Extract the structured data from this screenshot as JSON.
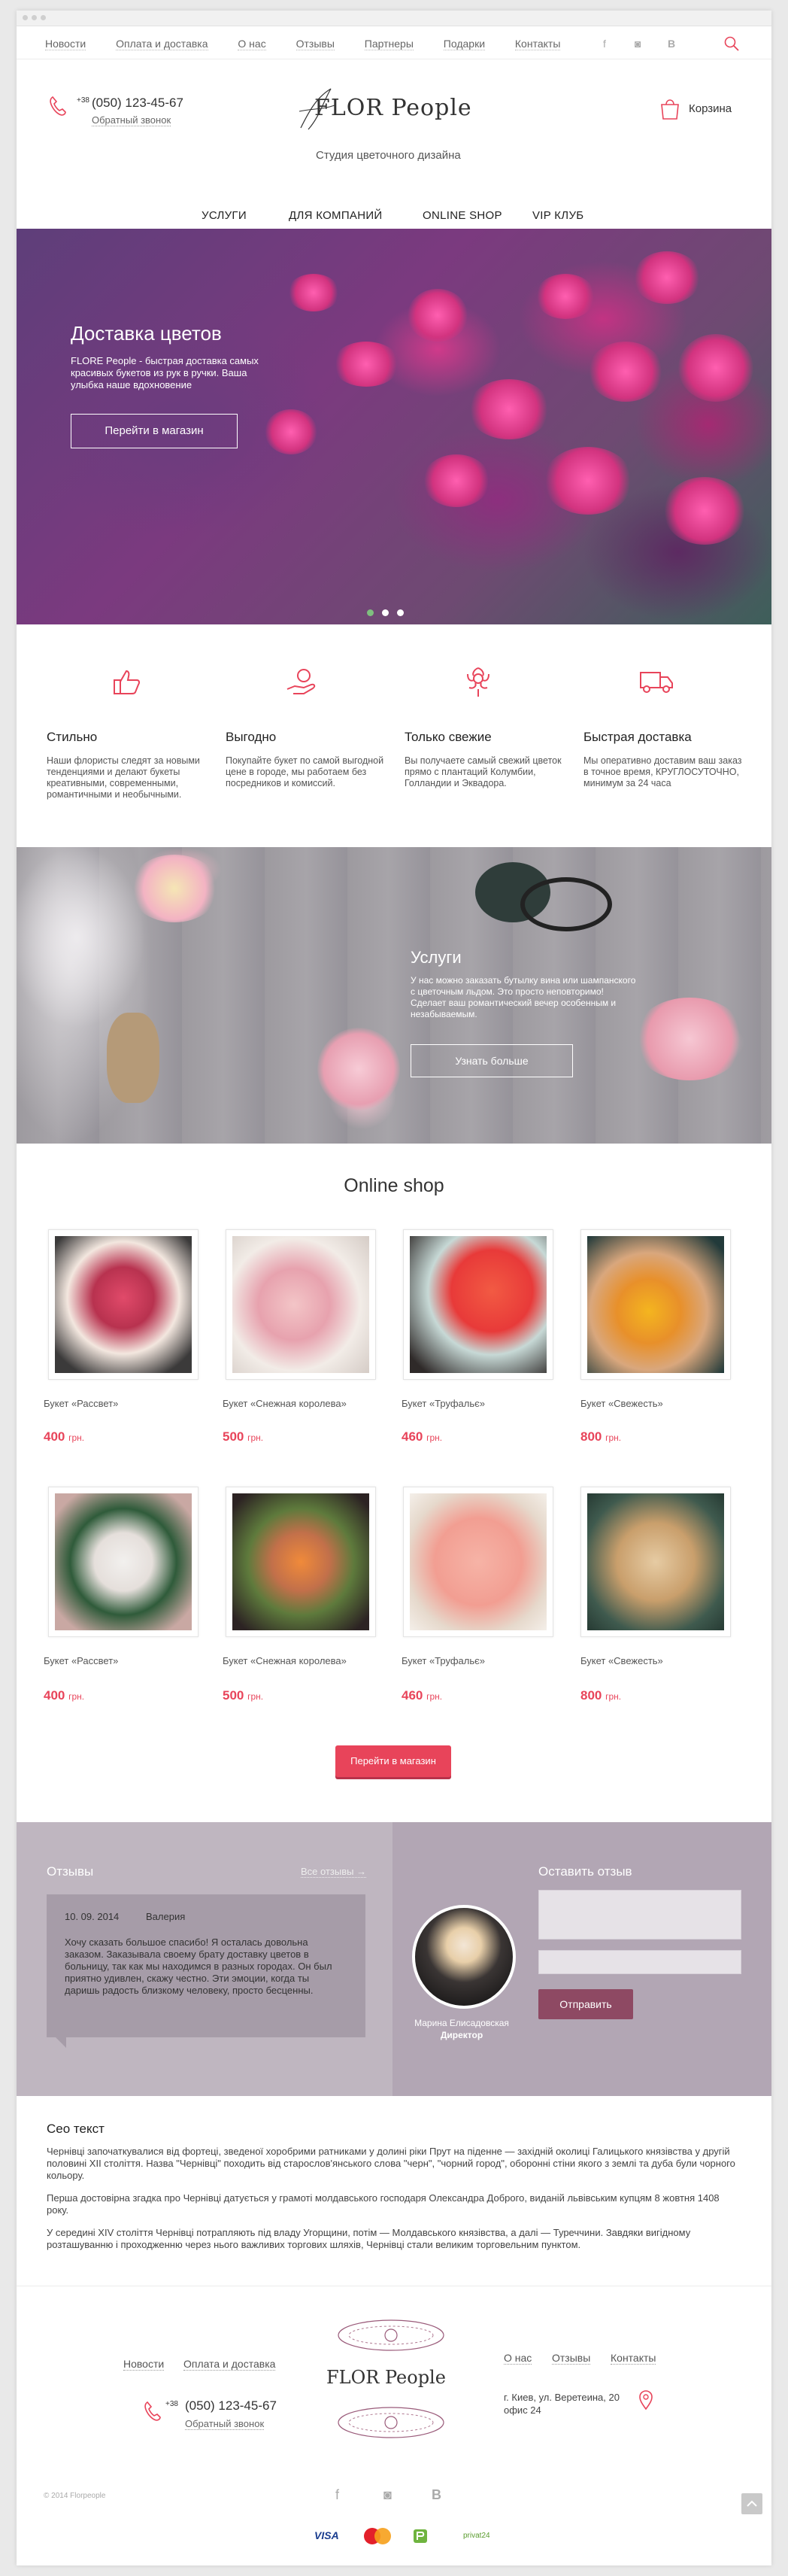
{
  "topnav": [
    "Новости",
    "Оплата и доставка",
    "О нас",
    "Отзывы",
    "Партнеры",
    "Подарки",
    "Контакты"
  ],
  "social": {
    "fb": "f",
    "ig": "◙",
    "vk": "B"
  },
  "header": {
    "phone_prefix": "+38",
    "phone": "(050) 123-45-67",
    "callback": "Обратный звонок",
    "logo": "FLOR People",
    "subtitle": "Студия цветочного дизайна",
    "cart": "Корзина"
  },
  "mainnav": [
    "УСЛУГИ",
    "ДЛЯ КОМПАНИЙ",
    "ONLINE SHOP",
    "VIP КЛУБ"
  ],
  "hero": {
    "title": "Доставка цветов",
    "text": "FLORE People - быстрая доставка самых красивых букетов из рук в ручки. Ваша улыбка наше вдохновение",
    "button": "Перейти в магазин",
    "slides_active": 1,
    "slides_total": 3
  },
  "features": [
    {
      "icon": "thumbs-up-icon",
      "title": "Стильно",
      "text": "Наши флористы следят за новыми тенденциями и делают букеты креативными, современными, романтичными и необычными."
    },
    {
      "icon": "money-hand-icon",
      "title": "Выгодно",
      "text": "Покупайте букет по самой выгодной цене в городе, мы работаем без посредников и комиссий."
    },
    {
      "icon": "flower-icon",
      "title": "Только свежие",
      "text": "Вы получаете самый свежий цветок прямо с плантаций Колумбии, Голландии и Эквадора."
    },
    {
      "icon": "delivery-truck-icon",
      "title": "Быстрая доставка",
      "text": "Мы оперативно доставим ваш заказ в точное время, КРУГЛОСУТОЧНО, минимум за 24 часа"
    }
  ],
  "services": {
    "title": "Услуги",
    "text": "У нас можно заказать бутылку вина или шампанского с цветочным льдом. Это просто неповторимо! Сделает ваш романтический вечер особенным и незабываемым.",
    "button": "Узнать больше"
  },
  "shop": {
    "title": "Online shop",
    "button": "Перейти в магазин",
    "currency": "грн.",
    "products": [
      {
        "name": "Букет «Рассвет»",
        "price": "400"
      },
      {
        "name": "Букет «Снежная королева»",
        "price": "500"
      },
      {
        "name": "Букет «Труфальє»",
        "price": "460"
      },
      {
        "name": "Букет «Свежесть»",
        "price": "800"
      },
      {
        "name": "Букет «Рассвет»",
        "price": "400"
      },
      {
        "name": "Букет «Снежная королева»",
        "price": "500"
      },
      {
        "name": "Букет «Труфальє»",
        "price": "460"
      },
      {
        "name": "Букет «Свежесть»",
        "price": "800"
      }
    ]
  },
  "reviews": {
    "title": "Отзывы",
    "all_link": "Все отзывы →",
    "date": "10. 09. 2014",
    "author": "Валерия",
    "text": "Хочу сказать большое спасибо! Я осталась довольна заказом. Заказывала своему брату доставку цветов в больницу, так как мы находимся в разных городах. Он был приятно удивлен, скажу честно. Эти эмоции, когда ты даришь радость близкому человеку, просто бесценны.",
    "person_name": "Марина Елисадовская",
    "person_role": "Директор",
    "form_title": "Оставить отзыв",
    "submit": "Отправить"
  },
  "seo": {
    "title": "Сео текст",
    "p1": "Чернівці започаткувалися від фортеці, зведеної хоробрими ратниками у долині ріки Прут на піденне — західній околиці Галицького князівства у другій половині XII століття. Назва \"Чернівці\" походить від старослов'янського слова \"черн\", \"чорний город\", оборонні стіни якого з землі та дуба були чорного кольору.",
    "p2": "Перша достовірна згадка про Чернівці датується у грамоті молдавського господаря Олександра Доброго, виданій львівським купцям 8 жовтня 1408 року.",
    "p3": "У середині XIV століття Чернівці потрапляють під владу Угорщини, потім — Молдавського князівства, а далі — Туреччини. Завдяки вигідному розташуванню і проходженню через нього важливих торгових шляхів, Чернівці стали великим торговельним пунктом."
  },
  "footer": {
    "nav_left": [
      "Новости",
      "Оплата и доставка"
    ],
    "nav_right": [
      "О нас",
      "Отзывы",
      "Контакты"
    ],
    "phone_prefix": "+38",
    "phone": "(050) 123-45-67",
    "callback": "Обратный звонок",
    "logo": "FLOR People",
    "address": "г. Киев, ул. Веретеина, 20 офис 24",
    "copyright": "© 2014 Florpeople",
    "payments": [
      "VISA",
      "MasterCard",
      "privat24"
    ]
  }
}
